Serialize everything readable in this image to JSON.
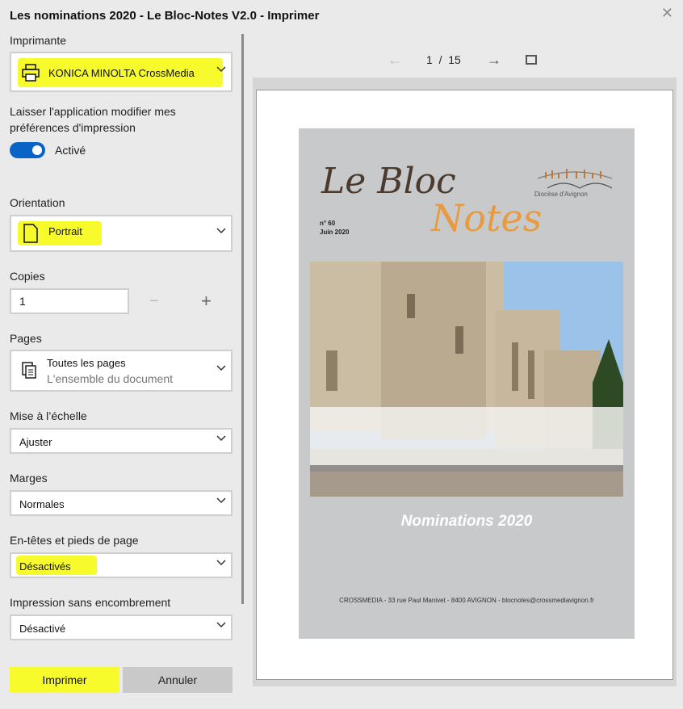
{
  "window": {
    "title": "Les nominations 2020 - Le Bloc-Notes V2.0 - Imprimer"
  },
  "printer": {
    "label": "Imprimante",
    "value": "KONICA MINOLTA CrossMedia"
  },
  "app_prefs": {
    "label": "Laisser l'application modifier mes préférences d'impression",
    "toggle_state": "Activé",
    "enabled": true
  },
  "orientation": {
    "label": "Orientation",
    "value": "Portrait"
  },
  "copies": {
    "label": "Copies",
    "value": "1",
    "minus": "−",
    "plus": "+"
  },
  "pages": {
    "label": "Pages",
    "value": "Toutes les pages",
    "subvalue": "L'ensemble du document"
  },
  "scale": {
    "label": "Mise à l’échelle",
    "value": "Ajuster"
  },
  "margins": {
    "label": "Marges",
    "value": "Normales"
  },
  "headers": {
    "label": "En-têtes et pieds de page",
    "value": "Désactivés"
  },
  "clutter": {
    "label": "Impression sans encombrement",
    "value": "Désactivé"
  },
  "buttons": {
    "print": "Imprimer",
    "cancel": "Annuler"
  },
  "nav": {
    "current_page": "1",
    "separator": "/",
    "total_pages": "15"
  },
  "cover": {
    "title_part1": "Le Bloc",
    "title_part2": "Notes",
    "issue_number": "n° 60",
    "issue_date": "Juin 2020",
    "headline": "Nominations 2020",
    "footer": "CROSSMEDIA - 33 rue Paul Manivet - 8400 AVIGNON - blocnotes@crossmediavignon.fr",
    "logo_text": "Diocèse d'Avignon"
  },
  "colors": {
    "highlight": "#f7fb2c",
    "toggle": "#0a64c8",
    "accent_orange": "#e79a3e"
  }
}
